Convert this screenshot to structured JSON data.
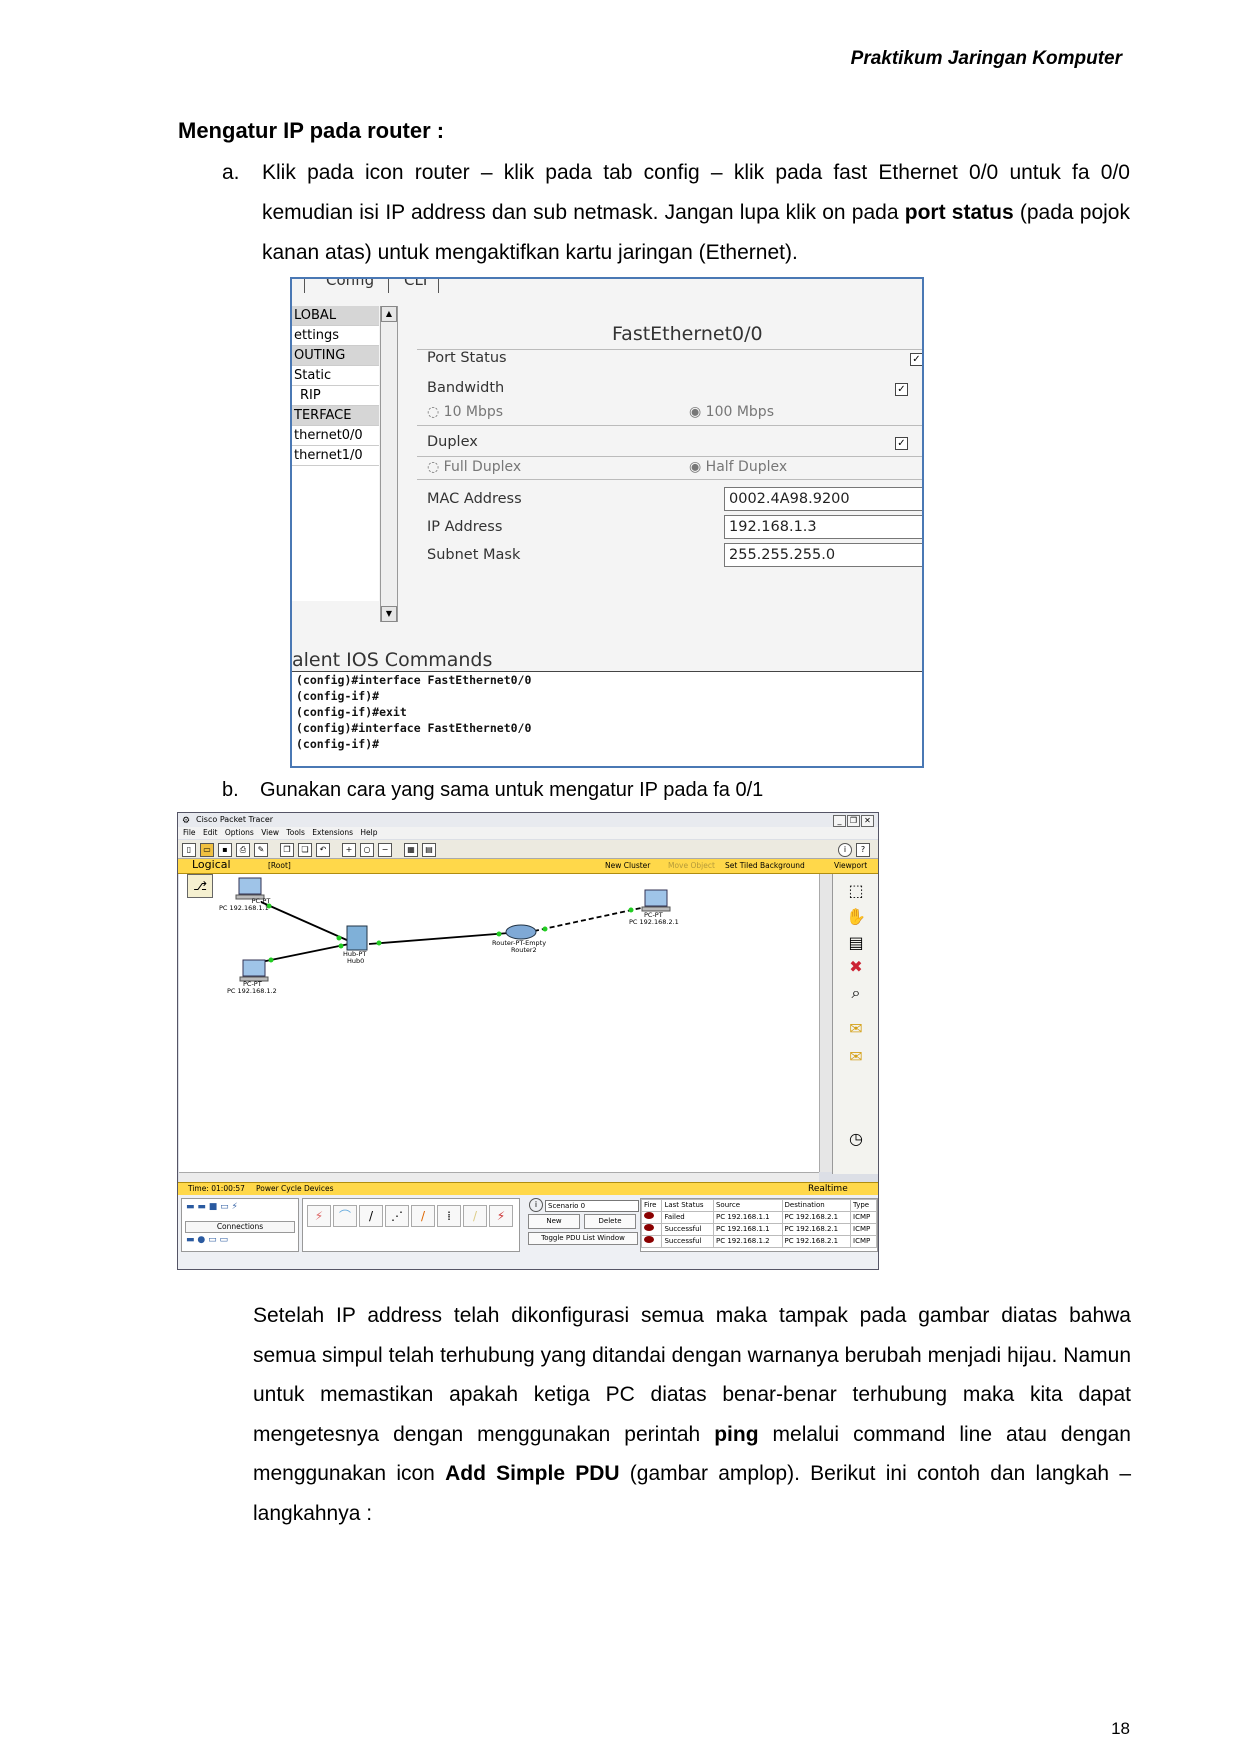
{
  "header": {
    "title": "Praktikum Jaringan Komputer"
  },
  "section": {
    "heading": "Mengatur IP pada router :",
    "item_a": {
      "label": "a.",
      "text_pre": "Klik pada icon router – klik pada tab config – klik pada fast Ethernet 0/0 untuk fa 0/0 kemudian isi IP address dan sub netmask. Jangan lupa klik on pada ",
      "text_bold": "port status",
      "text_post": " (pada pojok kanan atas) untuk mengaktifkan kartu jaringan (Ethernet)."
    },
    "item_b": {
      "label": "b.",
      "text": "Gunakan cara yang sama untuk mengatur IP pada fa 0/1"
    }
  },
  "router_config": {
    "tabs": [
      "Config",
      "CLI"
    ],
    "sidebar": [
      "LOBAL",
      "ettings",
      "OUTING",
      "Static",
      "RIP",
      "TERFACE",
      "thernet0/0",
      "thernet1/0"
    ],
    "panel_title": "FastEthernet0/0",
    "port_status_label": "Port Status",
    "bandwidth_label": "Bandwidth",
    "bw_10": "10 Mbps",
    "bw_100": "100 Mbps",
    "duplex_label": "Duplex",
    "full_duplex": "Full Duplex",
    "half_duplex": "Half Duplex",
    "mac_label": "MAC Address",
    "mac_value": "0002.4A98.9200",
    "ip_label": "IP Address",
    "ip_value": "192.168.1.3",
    "mask_label": "Subnet Mask",
    "mask_value": "255.255.255.0",
    "ios_title": "alent IOS Commands",
    "ios_lines": [
      "(config)#interface FastEthernet0/0",
      "(config-if)#",
      "(config-if)#exit",
      "(config)#interface FastEthernet0/0",
      "(config-if)#"
    ]
  },
  "packet_tracer": {
    "window_title": "Cisco Packet Tracer",
    "menu": [
      "File",
      "Edit",
      "Options",
      "View",
      "Tools",
      "Extensions",
      "Help"
    ],
    "bar": {
      "logical": "Logical",
      "root": "[Root]",
      "new_cluster": "New Cluster",
      "move_object": "Move Object",
      "set_bg": "Set Tiled Background",
      "viewport": "Viewport"
    },
    "devices": [
      {
        "type": "PC-PT",
        "name": "PC 192.168.1.1"
      },
      {
        "type": "PC-PT",
        "name": "PC 192.168.1.2"
      },
      {
        "type": "Hub-PT",
        "name": "Hub0"
      },
      {
        "type": "Router-PT-Empty",
        "name": "Router2"
      },
      {
        "type": "PC-PT",
        "name": "PC 192.168.2.1"
      }
    ],
    "status": {
      "time": "Time: 01:00:57",
      "power": "Power Cycle Devices",
      "mode": "Realtime"
    },
    "connections_label": "Connections",
    "scenario": "Scenario 0",
    "new_btn": "New",
    "delete_btn": "Delete",
    "toggle_btn": "Toggle PDU List Window",
    "pdu_headers": [
      "Fire",
      "Last Status",
      "Source",
      "Destination",
      "Type"
    ],
    "pdu_rows": [
      {
        "status": "Failed",
        "source": "PC 192.168.1.1",
        "dest": "PC 192.168.2.1",
        "type": "ICMP"
      },
      {
        "status": "Successful",
        "source": "PC 192.168.1.1",
        "dest": "PC 192.168.2.1",
        "type": "ICMP"
      },
      {
        "status": "Successful",
        "source": "PC 192.168.1.2",
        "dest": "PC 192.168.2.1",
        "type": "ICMP"
      }
    ]
  },
  "body": {
    "p_pre": "Setelah IP address telah dikonfigurasi semua maka tampak pada gambar diatas bahwa semua simpul telah terhubung yang ditandai dengan warnanya berubah menjadi hijau. Namun untuk memastikan apakah ketiga PC diatas benar-benar terhubung maka kita dapat mengetesnya dengan menggunakan perintah ",
    "ping": "ping",
    "p_mid": " melalui command line atau dengan menggunakan icon ",
    "pdu": "Add Simple PDU",
    "p_post": " (gambar amplop). Berikut ini contoh dan langkah – langkahnya :"
  },
  "page_number": "18"
}
